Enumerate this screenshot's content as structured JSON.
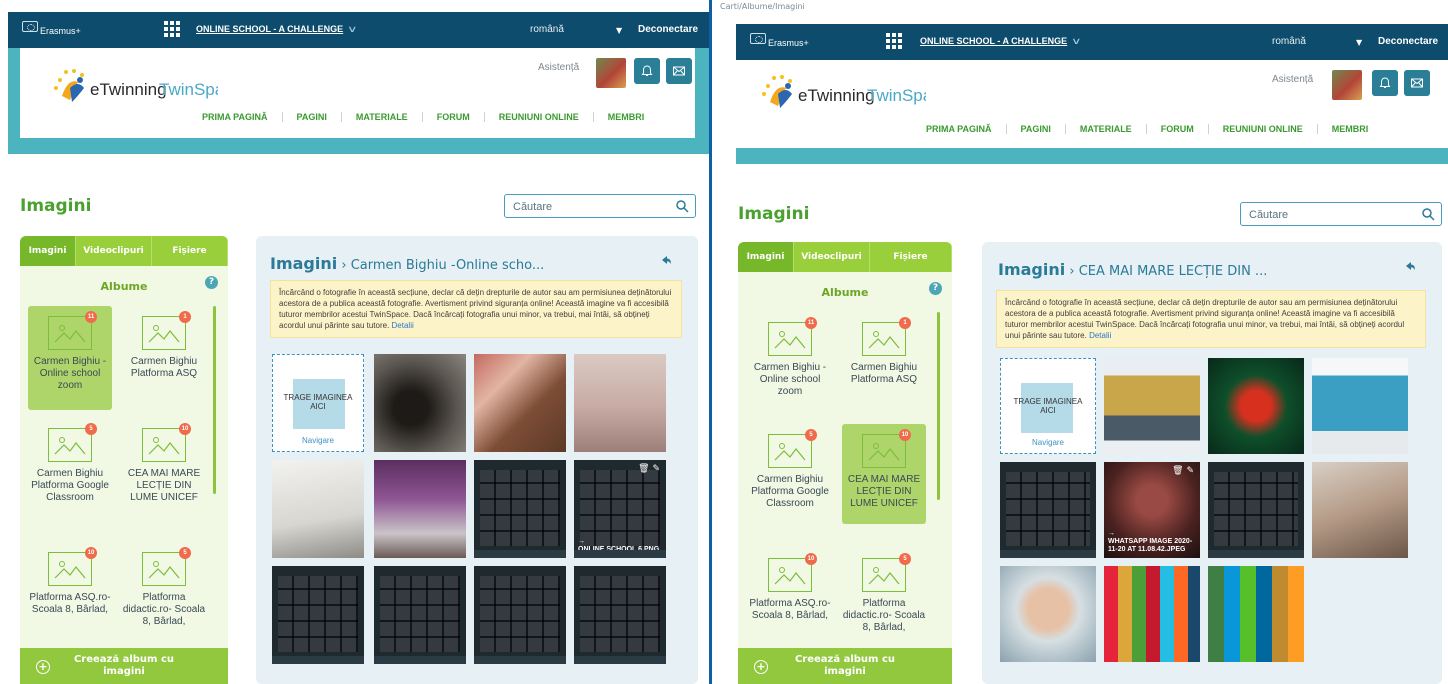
{
  "panels": {
    "left": {
      "topbar": {
        "erasmus": "Erasmus+",
        "project": "ONLINE SCHOOL - A CHALLENGE",
        "language": "română",
        "logout": "Deconectare"
      },
      "header": {
        "logo_e": "eTwinning",
        "logo_ts": "TwinSpace",
        "help": "Asistență",
        "nav": [
          "PRIMA PAGINĂ",
          "PAGINI",
          "MATERIALE",
          "FORUM",
          "REUNIUNI ONLINE",
          "MEMBRI"
        ]
      },
      "page_title": "Imagini",
      "search": {
        "placeholder": "Căutare"
      },
      "sidebar": {
        "tabs": [
          "Imagini",
          "Videoclipuri",
          "Fișiere"
        ],
        "albums_title": "Albume",
        "help_icon": "?",
        "albums": [
          {
            "label": "Carmen Bighiu -Online school zoom",
            "count": "11"
          },
          {
            "label": "Carmen Bighiu Platforma ASQ",
            "count": "1"
          },
          {
            "label": "Carmen Bighiu Platforma Google Classroom",
            "count": "5"
          },
          {
            "label": "CEA MAI MARE LECȚIE DIN LUME UNICEF",
            "count": "10"
          },
          {
            "label": "Platforma ASQ.ro- Scoala 8, Bârlad,",
            "count": "10"
          },
          {
            "label": "Platforma didactic.ro- Scoala 8, Bârlad,",
            "count": "5"
          }
        ],
        "create_album": "Creează album cu imagini"
      },
      "content": {
        "title_main": "Imagini",
        "title_sub": " › Carmen Bighiu -Online scho...",
        "notice": "Încărcând o fotografie în această secțiune, declar că dețin drepturile de autor sau am permisiunea deținătorului acestora de a publica această fotografie. Avertisment privind siguranța online! Această imagine va fi accesibilă tuturor membrilor acestui TwinSpace. Dacă încărcați fotografia unui minor, va trebui, mai întâi, să obțineți acordul unui părinte sau tutore.",
        "notice_link": "Detalii",
        "drop_text": "TRAGE IMAGINEA AICI",
        "drop_nav": "Navigare",
        "hover_caption": "→\nONLINE SCHOOL 6.PNG"
      }
    },
    "right": {
      "url": "Carti/Albume/Imagini",
      "topbar": {
        "erasmus": "Erasmus+",
        "project": "ONLINE SCHOOL - A CHALLENGE",
        "language": "română",
        "logout": "Deconectare"
      },
      "header": {
        "logo_e": "eTwinning",
        "logo_ts": "TwinSpace",
        "help": "Asistență",
        "nav": [
          "PRIMA PAGINĂ",
          "PAGINI",
          "MATERIALE",
          "FORUM",
          "REUNIUNI ONLINE",
          "MEMBRI"
        ]
      },
      "page_title": "Imagini",
      "search": {
        "placeholder": "Căutare"
      },
      "sidebar": {
        "tabs": [
          "Imagini",
          "Videoclipuri",
          "Fișiere"
        ],
        "albums_title": "Albume",
        "help_icon": "?",
        "albums": [
          {
            "label": "Carmen Bighiu -Online school zoom",
            "count": "11"
          },
          {
            "label": "Carmen Bighiu Platforma ASQ",
            "count": "1"
          },
          {
            "label": "Carmen Bighiu Platforma Google Classroom",
            "count": "5"
          },
          {
            "label": "CEA MAI MARE LECȚIE DIN LUME UNICEF",
            "count": "10"
          },
          {
            "label": "Platforma ASQ.ro- Scoala 8, Bârlad,",
            "count": "10"
          },
          {
            "label": "Platforma didactic.ro- Scoala 8, Bârlad,",
            "count": "5"
          }
        ],
        "create_album": "Creează album cu imagini"
      },
      "content": {
        "title_main": "Imagini",
        "title_sub": " › CEA MAI MARE LECȚIE DIN ...",
        "notice": "Încărcând o fotografie în această secțiune, declar că dețin drepturile de autor sau am permisiunea deținătorului acestora de a publica această fotografie. Avertisment privind siguranța online! Această imagine va fi accesibilă tuturor membrilor acestui TwinSpace. Dacă încărcați fotografia unui minor, va trebui, mai întâi, să obțineți acordul unui părinte sau tutore.",
        "notice_link": "Detalii",
        "drop_text": "TRAGE IMAGINEA AICI",
        "drop_nav": "Navigare",
        "hover_caption": "→\nWHATSAPP IMAGE 2020-11-20 AT 11.08.42.JPEG"
      }
    }
  },
  "colors": {
    "topbar": "#0d4c6c",
    "header_band": "#4bb4bf",
    "green": "#76b82a",
    "title_green": "#4aa12f",
    "badge": "#ef6b4c",
    "notice_bg": "#fdf3c8"
  },
  "icons": [
    "erasmus-flag-icon",
    "apps-grid-icon",
    "bell-icon",
    "mail-icon",
    "search-icon",
    "help-icon",
    "back-arrow-icon",
    "image-placeholder-icon",
    "plus-circle-icon",
    "trash-icon",
    "edit-icon"
  ]
}
